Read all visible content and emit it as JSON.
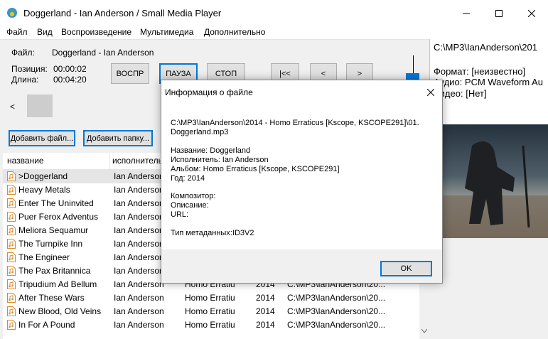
{
  "window": {
    "title": "Doggerland - Ian Anderson / Small Media Player"
  },
  "menu": [
    "Файл",
    "Вид",
    "Воспроизведение",
    "Мультимедиа",
    "Дополнительно"
  ],
  "player": {
    "file_label": "Файл:",
    "file_value": "Doggerland - Ian Anderson",
    "position_label": "Позиция:",
    "position_value": "00:00:02",
    "length_label": "Длина:",
    "length_value": "00:04:20",
    "play_label": "ВОСПР",
    "pause_label": "ПАУЗА",
    "stop_label": "СТОП",
    "prev_label": "|<<",
    "back_label": "<",
    "forward_label": ">",
    "seek_back_label": "<",
    "volume_level": 0.3
  },
  "info_panel": {
    "path": "C:\\MP3\\IanAnderson\\201",
    "format": "Формат: [неизвестно]",
    "audio": "Аудио: PCM Waveform Au",
    "video": "Видео: [Нет]"
  },
  "buttons": {
    "add_file": "Добавить файл...",
    "add_folder": "Добавить папку..."
  },
  "playlist": {
    "columns": [
      "название",
      "исполнитель"
    ],
    "rows": [
      {
        "title": ">Doggerland",
        "artist": "Ian Anderson",
        "album": "",
        "year": "",
        "path": ""
      },
      {
        "title": "Heavy Metals",
        "artist": "Ian Anderson",
        "album": "",
        "year": "",
        "path": ""
      },
      {
        "title": "Enter The Uninvited",
        "artist": "Ian Anderson",
        "album": "",
        "year": "",
        "path": ""
      },
      {
        "title": "Puer Ferox Adventus",
        "artist": "Ian Anderson",
        "album": "",
        "year": "",
        "path": ""
      },
      {
        "title": "Meliora Sequamur",
        "artist": "Ian Anderson",
        "album": "",
        "year": "",
        "path": ""
      },
      {
        "title": "The Turnpike Inn",
        "artist": "Ian Anderson",
        "album": "",
        "year": "",
        "path": ""
      },
      {
        "title": "The Engineer",
        "artist": "Ian Anderson",
        "album": "",
        "year": "",
        "path": ""
      },
      {
        "title": "The Pax Britannica",
        "artist": "Ian Anderson",
        "album": "",
        "year": "",
        "path": ""
      },
      {
        "title": "Tripudium Ad Bellum",
        "artist": "Ian Anderson",
        "album": "Homo Erratiu",
        "year": "2014",
        "path": "C:\\MP3\\IanAnderson\\20..."
      },
      {
        "title": "After These Wars",
        "artist": "Ian Anderson",
        "album": "Homo Erratiu",
        "year": "2014",
        "path": "C:\\MP3\\IanAnderson\\20..."
      },
      {
        "title": "New Blood, Old Veins",
        "artist": "Ian Anderson",
        "album": "Homo Erratiu",
        "year": "2014",
        "path": "C:\\MP3\\IanAnderson\\20..."
      },
      {
        "title": "In For A Pound",
        "artist": "Ian Anderson",
        "album": "Homo Erratiu",
        "year": "2014",
        "path": "C:\\MP3\\IanAnderson\\20..."
      }
    ]
  },
  "dialog": {
    "title": "Информация о файле",
    "path_line1": "C:\\MP3\\IanAnderson\\2014 - Homo Erraticus [Kscope, KSCOPE291]\\01.",
    "path_line2": "Doggerland.mp3",
    "name": "Название: Doggerland",
    "artist": "Исполнитель: Ian Anderson",
    "album": "Альбом: Homo Erraticus [Kscope, KSCOPE291]",
    "year": "Год: 2014",
    "composer": "Композитор:",
    "description": "Описание:",
    "url": "URL:",
    "meta_type": "Тип метаданных:ID3V2",
    "ok_label": "OK"
  },
  "colors": {
    "accent": "#0078d7",
    "selected_row": "#e5e5e5"
  }
}
